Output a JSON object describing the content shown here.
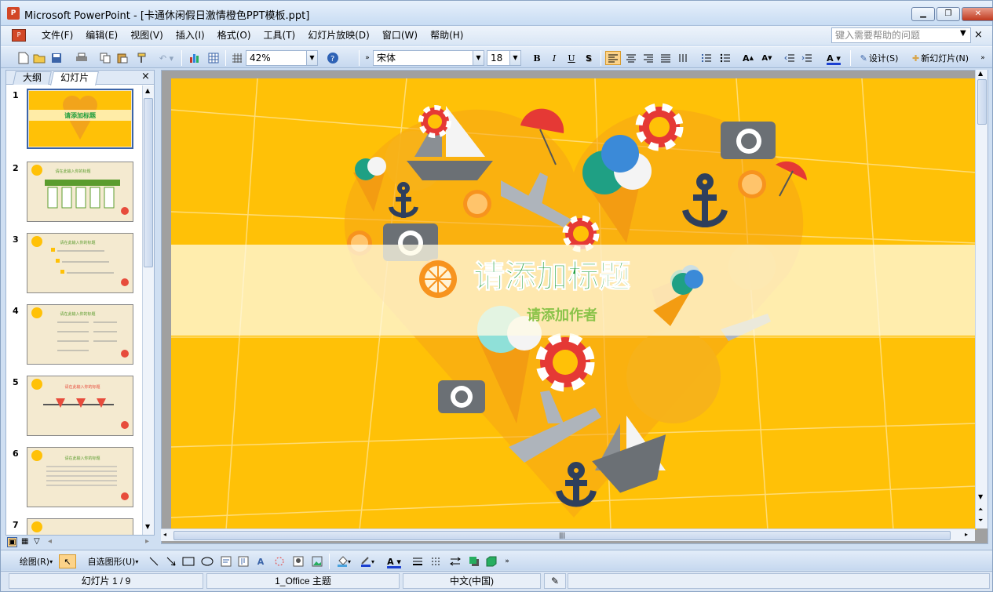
{
  "window": {
    "app_icon": "powerpoint-icon",
    "title": "Microsoft PowerPoint - [卡通休闲假日激情橙色PPT模板.ppt]",
    "controls": [
      "minimize-icon",
      "maximize-icon",
      "close-icon"
    ]
  },
  "menubar": {
    "items": [
      "文件(F)",
      "编辑(E)",
      "视图(V)",
      "插入(I)",
      "格式(O)",
      "工具(T)",
      "幻灯片放映(D)",
      "窗口(W)",
      "帮助(H)"
    ],
    "help_placeholder": "键入需要帮助的问题",
    "close": "×"
  },
  "toolbar": {
    "zoom": "42%",
    "font": "宋体",
    "font_size": "18",
    "bold": "B",
    "italic": "I",
    "underline": "U",
    "shadow": "S",
    "design_label": "设计(S)",
    "new_slide_label": "新幻灯片(N)"
  },
  "left_pane": {
    "tab_outline": "大纲",
    "tab_slides": "幻灯片",
    "close": "×",
    "thumbnails": [
      {
        "num": "1",
        "title": "请添加标题"
      },
      {
        "num": "2",
        "title": "请在此输入你的标题"
      },
      {
        "num": "3",
        "title": "请在此输入你的标题"
      },
      {
        "num": "4",
        "title": "请在此输入你的标题"
      },
      {
        "num": "5",
        "title": "请在此输入你的标题"
      },
      {
        "num": "6",
        "title": "请在此输入你的标题"
      },
      {
        "num": "7",
        "title": ""
      }
    ]
  },
  "slide": {
    "title": "请添加标题",
    "subtitle": "请添加作者"
  },
  "drawbar": {
    "draw_label": "绘图(R)",
    "autoshape_label": "自选图形(U)"
  },
  "statusbar": {
    "slide_info": "幻灯片 1 / 9",
    "theme": "1_Office 主题",
    "language": "中文(中国)"
  },
  "colors": {
    "slide_bg": "#ffc107",
    "title_green": "#1f9e3c",
    "subtitle_green": "#8bc34a",
    "orange": "#f7931e",
    "anchor": "#2e3f5c",
    "gray": "#8a8f94"
  }
}
